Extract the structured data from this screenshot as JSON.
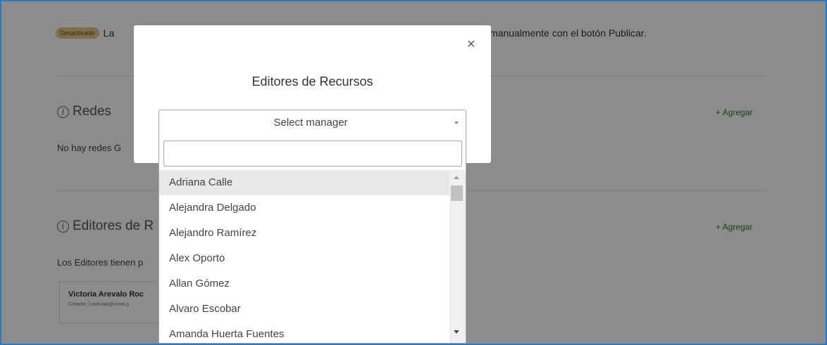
{
  "background": {
    "status_badge": "Desactivado",
    "status_text_left": "La",
    "status_text_right": "manualmente con el botón Publicar.",
    "redes": {
      "title": "Redes",
      "add_label": "+ Agregar",
      "empty_text": "No hay redes G"
    },
    "editores": {
      "title": "Editores de R",
      "add_label": "+ Agregar",
      "description": "Los Editores tienen p",
      "card": {
        "name": "Victoria Arevalo Roc",
        "sub": "Creador | varevalo@mma.g"
      }
    }
  },
  "modal": {
    "close_label": "×",
    "title": "Editores de Recursos",
    "select": {
      "selected": "Select manager"
    },
    "dropdown": {
      "search_value": "",
      "options": [
        "Adriana Calle",
        "Alejandra Delgado",
        "Alejandro Ramírez",
        "Alex Oporto",
        "Allan Gómez",
        "Alvaro Escobar",
        "Amanda Huerta Fuentes"
      ],
      "highlighted_index": 0
    }
  },
  "colors": {
    "frame_border": "#2b78c5",
    "badge_bg": "#e8c98b",
    "agregar": "#2e7d32"
  }
}
